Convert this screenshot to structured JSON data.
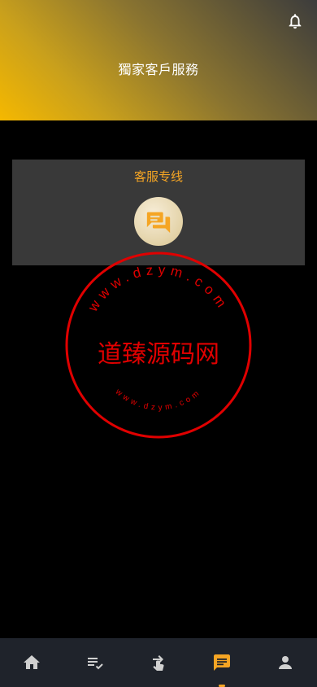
{
  "header": {
    "title": "獨家客戶服務",
    "bell_icon": "bell-icon"
  },
  "card": {
    "title": "客服专线",
    "icon": "chat-bubbles-icon"
  },
  "watermark": {
    "center_text": "道臻源码网",
    "ring_text": "www.dzym.com",
    "color": "#e00000"
  },
  "tabbar": {
    "items": [
      {
        "name": "home",
        "icon": "home-icon",
        "active": false
      },
      {
        "name": "orders",
        "icon": "list-check-icon",
        "active": false
      },
      {
        "name": "trade",
        "icon": "hand-swap-icon",
        "active": false
      },
      {
        "name": "service",
        "icon": "chat-icon",
        "active": true
      },
      {
        "name": "profile",
        "icon": "person-icon",
        "active": false
      }
    ],
    "active_color": "#f5a524",
    "inactive_color": "#d0d0d0"
  },
  "colors": {
    "accent": "#f5a524",
    "card_bg": "#393939",
    "tabbar_bg": "#1f232b"
  }
}
